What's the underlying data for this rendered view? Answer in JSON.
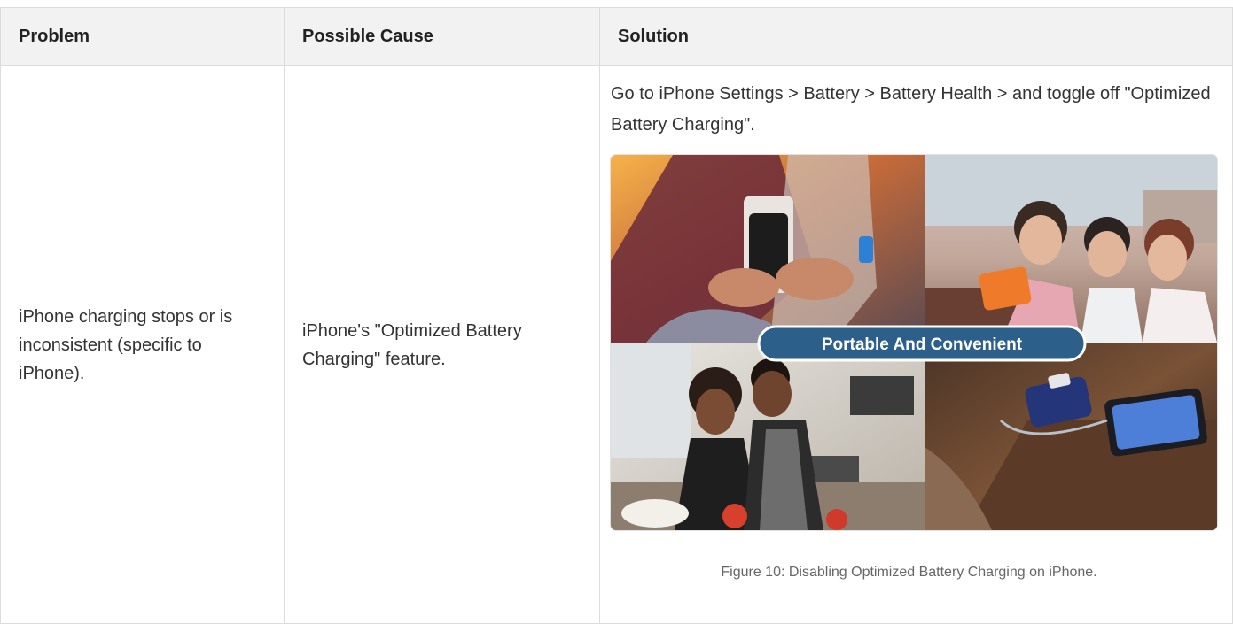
{
  "table": {
    "headers": [
      "Problem",
      "Possible Cause",
      "Solution"
    ],
    "row": {
      "problem": "iPhone charging stops or is inconsistent (specific to iPhone).",
      "cause": "iPhone's \"Optimized Battery Charging\" feature.",
      "solution": "Go to iPhone Settings > Battery > Battery Health > and toggle off \"Optimized Battery Charging\".",
      "figure": {
        "banner_text": "Portable And Convenient",
        "caption": "Figure 10: Disabling Optimized Battery Charging on iPhone."
      }
    }
  },
  "colors": {
    "header_bg": "#f2f2f2",
    "border": "#dcdcdc",
    "banner_bg": "#2c5f8a",
    "banner_border": "#ffffff"
  }
}
